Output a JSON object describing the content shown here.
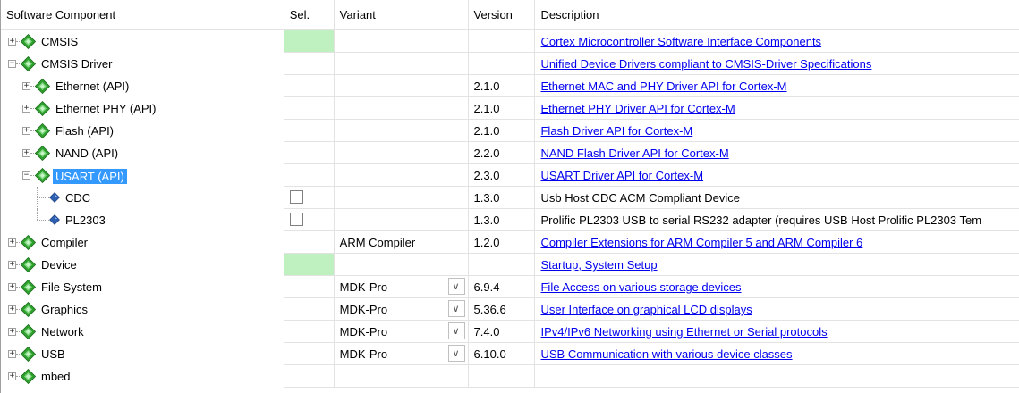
{
  "header": {
    "component": "Software Component",
    "sel": "Sel.",
    "variant": "Variant",
    "version": "Version",
    "description": "Description"
  },
  "rows": [
    {
      "name": "CMSIS",
      "level": 0,
      "expander": "+",
      "icon": "gem",
      "sel": "green",
      "variant": "",
      "version": "",
      "description": "Cortex Microcontroller Software Interface Components",
      "link": true
    },
    {
      "name": "CMSIS Driver",
      "level": 0,
      "expander": "-",
      "icon": "gem",
      "sel": "",
      "variant": "",
      "version": "",
      "description": "Unified Device Drivers compliant to CMSIS-Driver Specifications",
      "link": true
    },
    {
      "name": "Ethernet (API)",
      "level": 1,
      "expander": "+",
      "icon": "gem",
      "sel": "",
      "variant": "",
      "version": "2.1.0",
      "description": "Ethernet MAC and PHY Driver API for Cortex-M",
      "link": true
    },
    {
      "name": "Ethernet PHY (API)",
      "level": 1,
      "expander": "+",
      "icon": "gem",
      "sel": "",
      "variant": "",
      "version": "2.1.0",
      "description": "Ethernet PHY Driver API for Cortex-M",
      "link": true
    },
    {
      "name": "Flash (API)",
      "level": 1,
      "expander": "+",
      "icon": "gem",
      "sel": "",
      "variant": "",
      "version": "2.1.0",
      "description": "Flash Driver API for Cortex-M",
      "link": true
    },
    {
      "name": "NAND (API)",
      "level": 1,
      "expander": "+",
      "icon": "gem",
      "sel": "",
      "variant": "",
      "version": "2.2.0",
      "description": "NAND Flash Driver API for Cortex-M",
      "link": true
    },
    {
      "name": "USART (API)",
      "level": 1,
      "expander": "-",
      "icon": "gem",
      "sel": "",
      "variant": "",
      "version": "2.3.0",
      "description": "USART Driver API for Cortex-M",
      "link": true,
      "selected": true
    },
    {
      "name": "CDC",
      "level": 2,
      "expander": "",
      "icon": "leaf",
      "sel": "checkbox",
      "variant": "",
      "version": "1.3.0",
      "description": "Usb Host CDC ACM Compliant Device",
      "link": false
    },
    {
      "name": "PL2303",
      "level": 2,
      "expander": "",
      "icon": "leaf",
      "sel": "checkbox",
      "variant": "",
      "version": "1.3.0",
      "description": "Prolific PL2303 USB to serial RS232 adapter (requires USB Host Prolific PL2303 Tem",
      "link": false
    },
    {
      "name": "Compiler",
      "level": 0,
      "expander": "+",
      "icon": "gem",
      "sel": "",
      "variant": "ARM Compiler",
      "version": "1.2.0",
      "description": "Compiler Extensions for ARM Compiler 5 and ARM Compiler 6",
      "link": true
    },
    {
      "name": "Device",
      "level": 0,
      "expander": "+",
      "icon": "gem",
      "sel": "green",
      "variant": "",
      "version": "",
      "description": "Startup, System Setup",
      "link": true
    },
    {
      "name": "File System",
      "level": 0,
      "expander": "+",
      "icon": "gem",
      "sel": "",
      "variant": "MDK-Pro",
      "dropdown": true,
      "version": "6.9.4",
      "description": "File Access on various storage devices",
      "link": true
    },
    {
      "name": "Graphics",
      "level": 0,
      "expander": "+",
      "icon": "gem",
      "sel": "",
      "variant": "MDK-Pro",
      "dropdown": true,
      "version": "5.36.6",
      "description": "User Interface on graphical LCD displays",
      "link": true
    },
    {
      "name": "Network",
      "level": 0,
      "expander": "+",
      "icon": "gem",
      "sel": "",
      "variant": "MDK-Pro",
      "dropdown": true,
      "version": "7.4.0",
      "description": "IPv4/IPv6 Networking using Ethernet or Serial protocols",
      "link": true
    },
    {
      "name": "USB",
      "level": 0,
      "expander": "+",
      "icon": "gem",
      "sel": "",
      "variant": "MDK-Pro",
      "dropdown": true,
      "version": "6.10.0",
      "description": "USB Communication with various device classes",
      "link": true
    },
    {
      "name": "mbed",
      "level": 0,
      "expander": "+",
      "icon": "gem",
      "sel": "",
      "variant": "",
      "version": "",
      "description": "",
      "link": false
    }
  ],
  "colors": {
    "selected": "#3399ff",
    "sel_green": "#bff0bf",
    "link": "#0000ee",
    "gem": "#2ea02e"
  }
}
